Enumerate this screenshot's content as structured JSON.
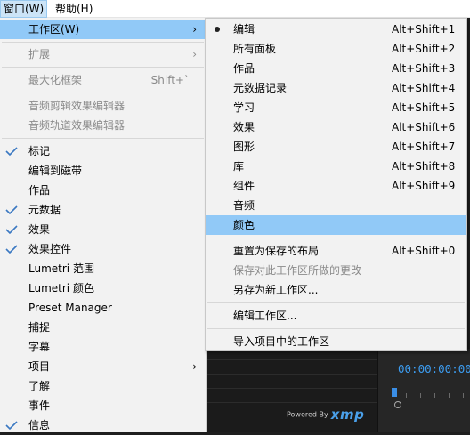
{
  "menubar": {
    "items": [
      {
        "label": "窗口(W)"
      },
      {
        "label": "帮助(H)"
      }
    ]
  },
  "window_menu": {
    "items": [
      {
        "label": "工作区(W)",
        "has_submenu": true,
        "highlighted": true
      },
      {
        "label": "扩展",
        "has_submenu": true,
        "disabled": true
      },
      {
        "label": "最大化框架",
        "shortcut": "Shift+`",
        "disabled": true
      },
      {
        "label": "音频剪辑效果编辑器",
        "disabled": true
      },
      {
        "label": "音频轨道效果编辑器",
        "disabled": true
      },
      {
        "label": "标记",
        "checked": true
      },
      {
        "label": "编辑到磁带"
      },
      {
        "label": "作品"
      },
      {
        "label": "元数据",
        "checked": true
      },
      {
        "label": "效果",
        "checked": true
      },
      {
        "label": "效果控件",
        "checked": true
      },
      {
        "label": "Lumetri 范围"
      },
      {
        "label": "Lumetri 颜色"
      },
      {
        "label": "Preset Manager"
      },
      {
        "label": "捕捉"
      },
      {
        "label": "字幕"
      },
      {
        "label": "项目",
        "has_submenu": true
      },
      {
        "label": "了解"
      },
      {
        "label": "事件"
      },
      {
        "label": "信息",
        "checked": true
      }
    ]
  },
  "workspace_submenu": {
    "items": [
      {
        "label": "编辑",
        "shortcut": "Alt+Shift+1",
        "active": true
      },
      {
        "label": "所有面板",
        "shortcut": "Alt+Shift+2"
      },
      {
        "label": "作品",
        "shortcut": "Alt+Shift+3"
      },
      {
        "label": "元数据记录",
        "shortcut": "Alt+Shift+4"
      },
      {
        "label": "学习",
        "shortcut": "Alt+Shift+5"
      },
      {
        "label": "效果",
        "shortcut": "Alt+Shift+6"
      },
      {
        "label": "图形",
        "shortcut": "Alt+Shift+7"
      },
      {
        "label": "库",
        "shortcut": "Alt+Shift+8"
      },
      {
        "label": "组件",
        "shortcut": "Alt+Shift+9"
      },
      {
        "label": "音频"
      },
      {
        "label": "颜色",
        "highlighted": true
      },
      {
        "label": "重置为保存的布局",
        "shortcut": "Alt+Shift+0"
      },
      {
        "label": "保存对此工作区所做的更改",
        "disabled": true
      },
      {
        "label": "另存为新工作区..."
      },
      {
        "label": "编辑工作区..."
      },
      {
        "label": "导入项目中的工作区"
      }
    ]
  },
  "background": {
    "timecode": "00:00:00:00",
    "powered_by": "Powered By",
    "xmp_logo": "xmp"
  },
  "colors": {
    "highlight": "#91c9f7",
    "menu_bg": "#f2f2f2",
    "timecode": "#3c9cf0"
  }
}
